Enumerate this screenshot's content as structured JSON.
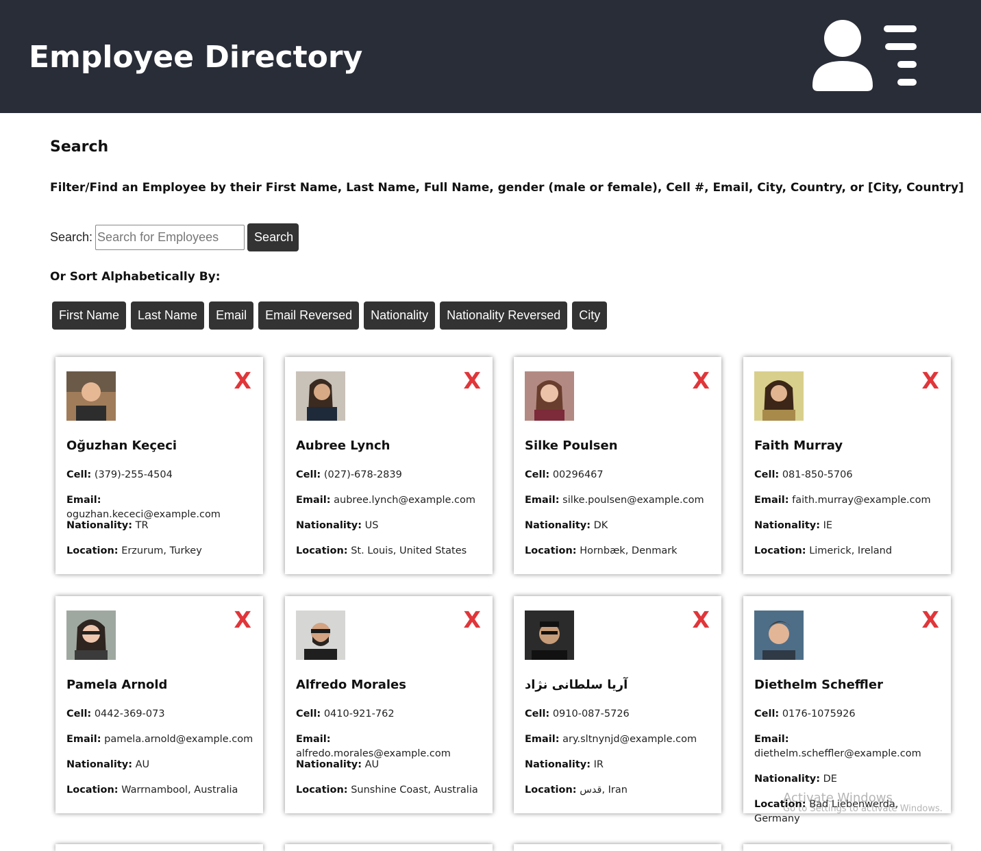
{
  "header": {
    "title": "Employee Directory",
    "icon": "user-list-icon"
  },
  "search": {
    "title": "Search",
    "description": "Filter/Find an Employee by their First Name, Last Name, Full Name, gender (male or female), Cell #, Email, City, Country, or [City, Country]",
    "label": "Search:",
    "placeholder": "Search for Employees",
    "button": "Search"
  },
  "sort": {
    "title": "Or Sort Alphabetically By:",
    "buttons": [
      "First Name",
      "Last Name",
      "Email",
      "Email Reversed",
      "Nationality",
      "Nationality Reversed",
      "City"
    ]
  },
  "labels": {
    "cell": "Cell:",
    "email": "Email:",
    "nationality": "Nationality:",
    "location": "Location:",
    "remove": "X"
  },
  "colors": {
    "header_bg": "#292d38",
    "button_bg": "#333333",
    "remove": "#e0363a"
  },
  "employees": [
    {
      "name": "Oğuzhan Keçeci",
      "cell": "(379)-255-4504",
      "email": "oguzhan.kececi@example.com",
      "nationality": "TR",
      "location": "Erzurum, Turkey"
    },
    {
      "name": "Aubree Lynch",
      "cell": "(027)-678-2839",
      "email": "aubree.lynch@example.com",
      "nationality": "US",
      "location": "St. Louis, United States"
    },
    {
      "name": "Silke Poulsen",
      "cell": "00296467",
      "email": "silke.poulsen@example.com",
      "nationality": "DK",
      "location": "Hornbæk, Denmark"
    },
    {
      "name": "Faith Murray",
      "cell": "081-850-5706",
      "email": "faith.murray@example.com",
      "nationality": "IE",
      "location": "Limerick, Ireland"
    },
    {
      "name": "Pamela Arnold",
      "cell": "0442-369-073",
      "email": "pamela.arnold@example.com",
      "nationality": "AU",
      "location": "Warrnambool, Australia"
    },
    {
      "name": "Alfredo Morales",
      "cell": "0410-921-762",
      "email": "alfredo.morales@example.com",
      "nationality": "AU",
      "location": "Sunshine Coast, Australia"
    },
    {
      "name": "آریا سلطانی نژاد",
      "cell": "0910-087-5726",
      "email": "ary.sltnynjd@example.com",
      "nationality": "IR",
      "location": "قدس, Iran"
    },
    {
      "name": "Diethelm Scheffler",
      "cell": "0176-1075926",
      "email": "diethelm.scheffler@example.com",
      "nationality": "DE",
      "location": "Bad Liebenwerda, Germany"
    }
  ],
  "watermark": {
    "line1": "Activate Windows",
    "line2": "Go to Settings to activate Windows."
  }
}
